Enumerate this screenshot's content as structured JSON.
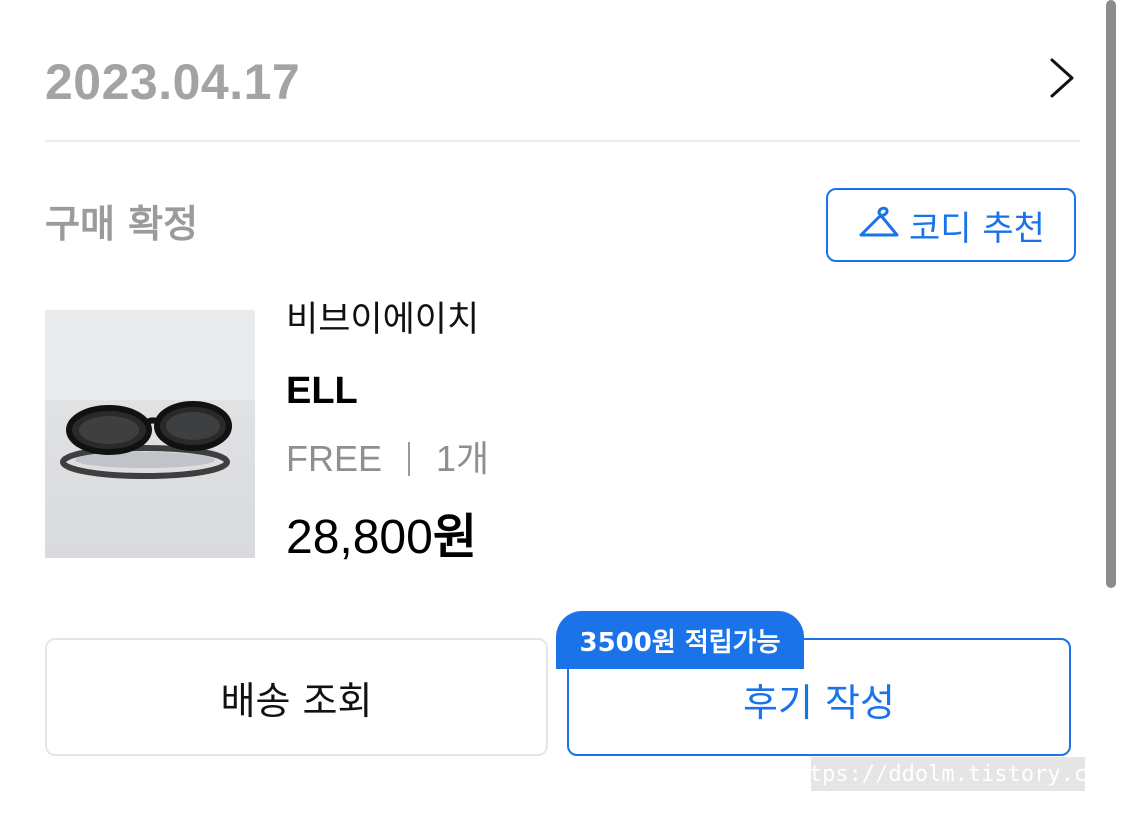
{
  "order": {
    "date": "2023.04.17",
    "status": "구매 확정"
  },
  "outfit_button": {
    "label": "코디 추천",
    "icon": "hanger-icon"
  },
  "product": {
    "brand": "비브이에이치",
    "name": "ELL",
    "option": "FREE",
    "quantity": "1개",
    "price": "28,800",
    "currency": "원",
    "image": "sunglasses-product-photo"
  },
  "actions": {
    "track_label": "배송 조회",
    "review_label": "후기 작성",
    "review_points_badge": "3500원 적립가능"
  },
  "watermark": "https://ddolm.tistory.com",
  "colors": {
    "accent": "#1a73e8",
    "muted_text": "#9b9b9b",
    "divider": "#ededed"
  }
}
